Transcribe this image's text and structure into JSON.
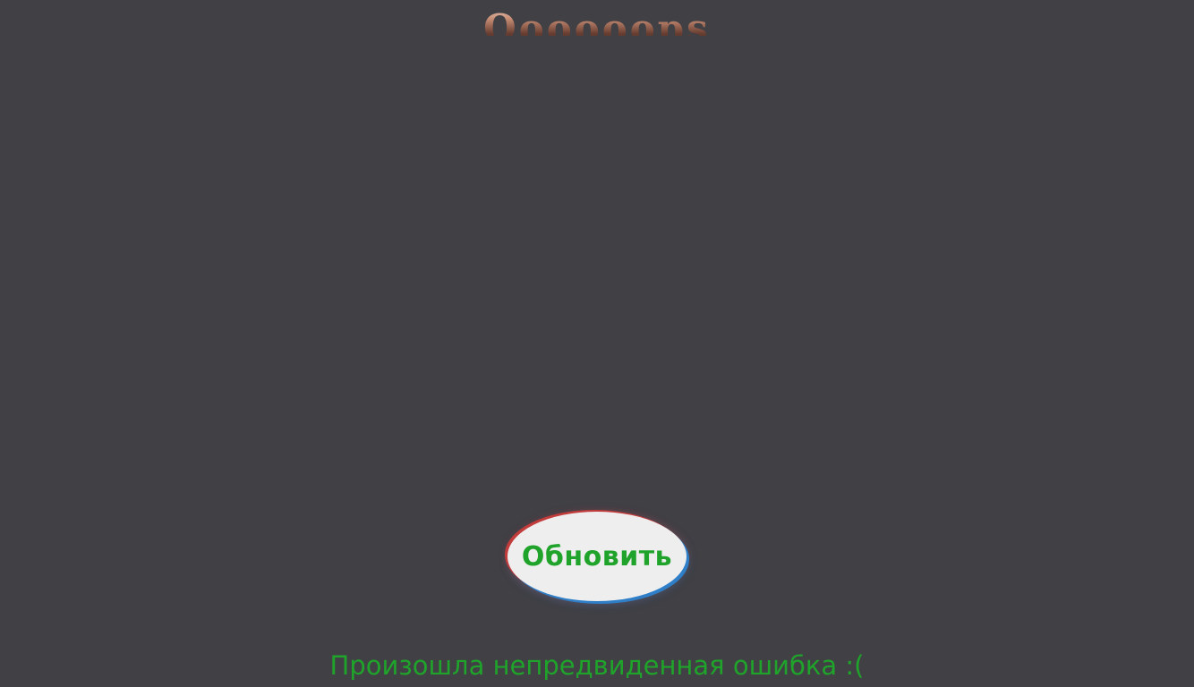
{
  "header": {
    "title": "Oooooops"
  },
  "actions": {
    "refresh_label": "Обновить"
  },
  "status": {
    "error_message": "Произошла непредвиденная ошибка :("
  },
  "colors": {
    "background": "#404045",
    "accent_green": "#1fa32a",
    "button_face": "#eeeeee",
    "glow_red": "#c23c3c",
    "glow_blue": "#2f7fc8"
  }
}
